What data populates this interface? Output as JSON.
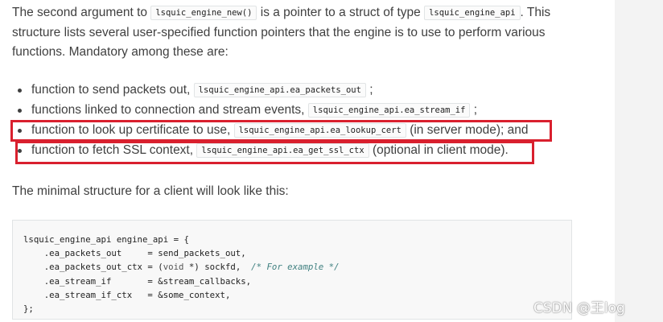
{
  "intro": {
    "line1_a": "The second argument to ",
    "line1_code1": "lsquic_engine_new()",
    "line1_b": " is a pointer to a struct of type ",
    "line1_code2": "lsquic_engine_api",
    "line1_c": ". This",
    "line2": "structure lists several user-specified function pointers that the engine is to use to perform various",
    "line3": "functions. Mandatory among these are:"
  },
  "bullets": [
    {
      "text": "function to send packets out, ",
      "code": "lsquic_engine_api.ea_packets_out",
      "after": " ;"
    },
    {
      "text": "functions linked to connection and stream events, ",
      "code": "lsquic_engine_api.ea_stream_if",
      "after": " ;"
    },
    {
      "text": "function to look up certificate to use, ",
      "code": "lsquic_engine_api.ea_lookup_cert",
      "after": " (in server mode); and"
    },
    {
      "text": "function to fetch SSL context, ",
      "code": "lsquic_engine_api.ea_get_ssl_ctx",
      "after": " (optional in client mode)."
    }
  ],
  "minimal_text": "The minimal structure for a client will look like this:",
  "code": {
    "line1": "lsquic_engine_api engine_api = {",
    "line2": "    .ea_packets_out     = send_packets_out,",
    "line3_a": "    .ea_packets_out_ctx = (",
    "line3_type": "void",
    "line3_b": " *) sockfd,  ",
    "line3_comment": "/* For example */",
    "line4": "    .ea_stream_if       = &stream_callbacks,",
    "line5": "    .ea_stream_if_ctx   = &some_context,",
    "line6": "};"
  },
  "watermark": "CSDN @王log",
  "colors": {
    "highlight": "#d9202e",
    "text": "#404040",
    "code_bg": "#f8f8f8"
  }
}
